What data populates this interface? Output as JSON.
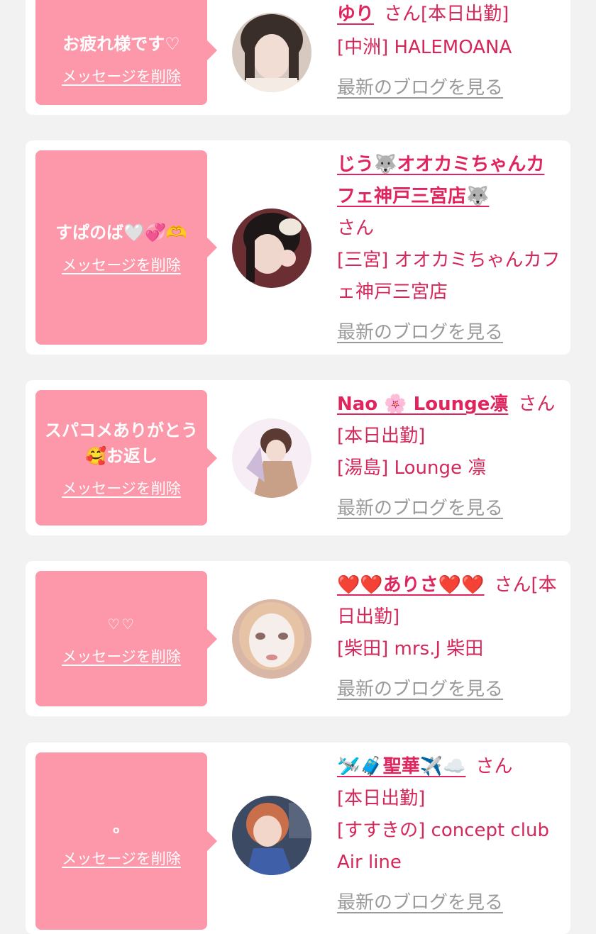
{
  "cards": [
    {
      "message": "お疲れ様です♡",
      "delete_label": "メッセージを削除",
      "name": "ゆり",
      "san": "さん",
      "status": "[本日出勤]",
      "shop": "[中洲] HALEMOANA",
      "blog_label": "最新のブログを見る"
    },
    {
      "message": "すぱのば🤍💞🫶",
      "delete_label": "メッセージを削除",
      "name": "じう🐺オオカミちゃんカフェ神戸三宮店🐺",
      "san": "さん",
      "status": "",
      "shop": "[三宮] オオカミちゃんカフェ神戸三宮店",
      "blog_label": "最新のブログを見る"
    },
    {
      "message": "スパコメありがとう🥰お返し",
      "delete_label": "メッセージを削除",
      "name": "Nao 🌸 Lounge凛",
      "san": "さん",
      "status": "[本日出勤]",
      "shop": "[湯島] Lounge 凛",
      "blog_label": "最新のブログを見る"
    },
    {
      "message": "♡♡",
      "delete_label": "メッセージを削除",
      "name": "❤️❤️ありさ❤️❤️",
      "san": "さん",
      "status": "[本日出勤]",
      "shop": "[柴田] mrs.J 柴田",
      "blog_label": "最新のブログを見る"
    },
    {
      "message": "。",
      "delete_label": "メッセージを削除",
      "name": "🛩️🧳聖華✈️☁️",
      "san": "さん",
      "status": "[本日出勤]",
      "shop": "[すすきの] concept club Air line",
      "blog_label": "最新のブログを見る"
    }
  ],
  "colors": {
    "background": "#f2f2f2",
    "card": "#ffffff",
    "bubble": "#fd98aa",
    "accent_text": "#d5285a",
    "link_gray": "#9a9a9a"
  }
}
